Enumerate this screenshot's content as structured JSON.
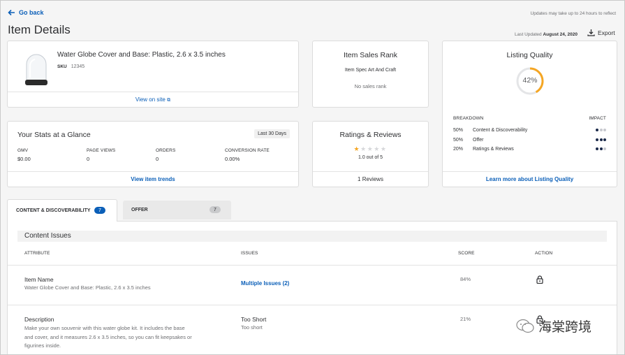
{
  "header": {
    "go_back": "Go back",
    "notice": "Updates may take up to 24 hours to reflect",
    "title": "Item Details",
    "last_updated_label": "Last Updated",
    "last_updated_value": "August 24, 2020",
    "export_label": "Export"
  },
  "item": {
    "name": "Water Globe Cover and Base: Plastic, 2.6 x 3.5 inches",
    "sku_label": "SKU",
    "sku_value": "12345",
    "view_on_site": "View on site"
  },
  "sales_rank": {
    "title": "Item Sales Rank",
    "category": "Item Spec Art And Craft",
    "value": "No sales rank"
  },
  "listing_quality": {
    "title": "Listing Quality",
    "percent_label": "42%",
    "percent": 42,
    "breakdown_label": "BREAKDOWN",
    "impact_label": "IMPACT",
    "rows": [
      {
        "pct": "50%",
        "label": "Content & Discoverability",
        "impact": 1
      },
      {
        "pct": "50%",
        "label": "Offer",
        "impact": 3
      },
      {
        "pct": "20%",
        "label": "Ratings & Reviews",
        "impact": 2
      }
    ],
    "learn_more": "Learn more about Listing Quality"
  },
  "stats": {
    "title": "Your Stats at a Glance",
    "period": "Last 30 Days",
    "metrics": [
      {
        "label": "GMV",
        "value": "$0.00"
      },
      {
        "label": "PAGE VIEWS",
        "value": "0"
      },
      {
        "label": "ORDERS",
        "value": "0"
      },
      {
        "label": "CONVERSION RATE",
        "value": "0.00%"
      }
    ],
    "view_trends": "View item trends"
  },
  "ratings": {
    "title": "Ratings & Reviews",
    "rating": 1,
    "rating_text": "1.0 out of 5",
    "reviews": "1 Reviews"
  },
  "tabs": [
    {
      "label": "CONTENT & DISCOVERABILITY",
      "count": "7"
    },
    {
      "label": "OFFER",
      "count": "7"
    }
  ],
  "content_issues": {
    "title": "Content Issues",
    "columns": {
      "attribute": "ATTRIBUTE",
      "issues": "ISSUES",
      "score": "SCORE",
      "action": "ACTION"
    },
    "rows": [
      {
        "attribute": "Item Name",
        "detail": "Water Globe Cover and Base: Plastic, 2.6 x 3.5 inches",
        "issue": "Multiple Issues (2)",
        "issue_sub": "",
        "score": "84%"
      },
      {
        "attribute": "Description",
        "detail_lines": [
          "Make your own souvenir with this water globe kit. It includes the base",
          "and cover, and it measures 2.6 x 3.5 inches, so you can fit keepsakes or",
          "figurines inside."
        ],
        "issue": "Too Short",
        "issue_sub": "Too short",
        "score": "21%"
      }
    ]
  },
  "watermark": "海棠跨境",
  "colors": {
    "accent": "#0b5fb8",
    "ring": "#f5a623",
    "star": "#f5a623",
    "badge": "#0b5fb8"
  }
}
